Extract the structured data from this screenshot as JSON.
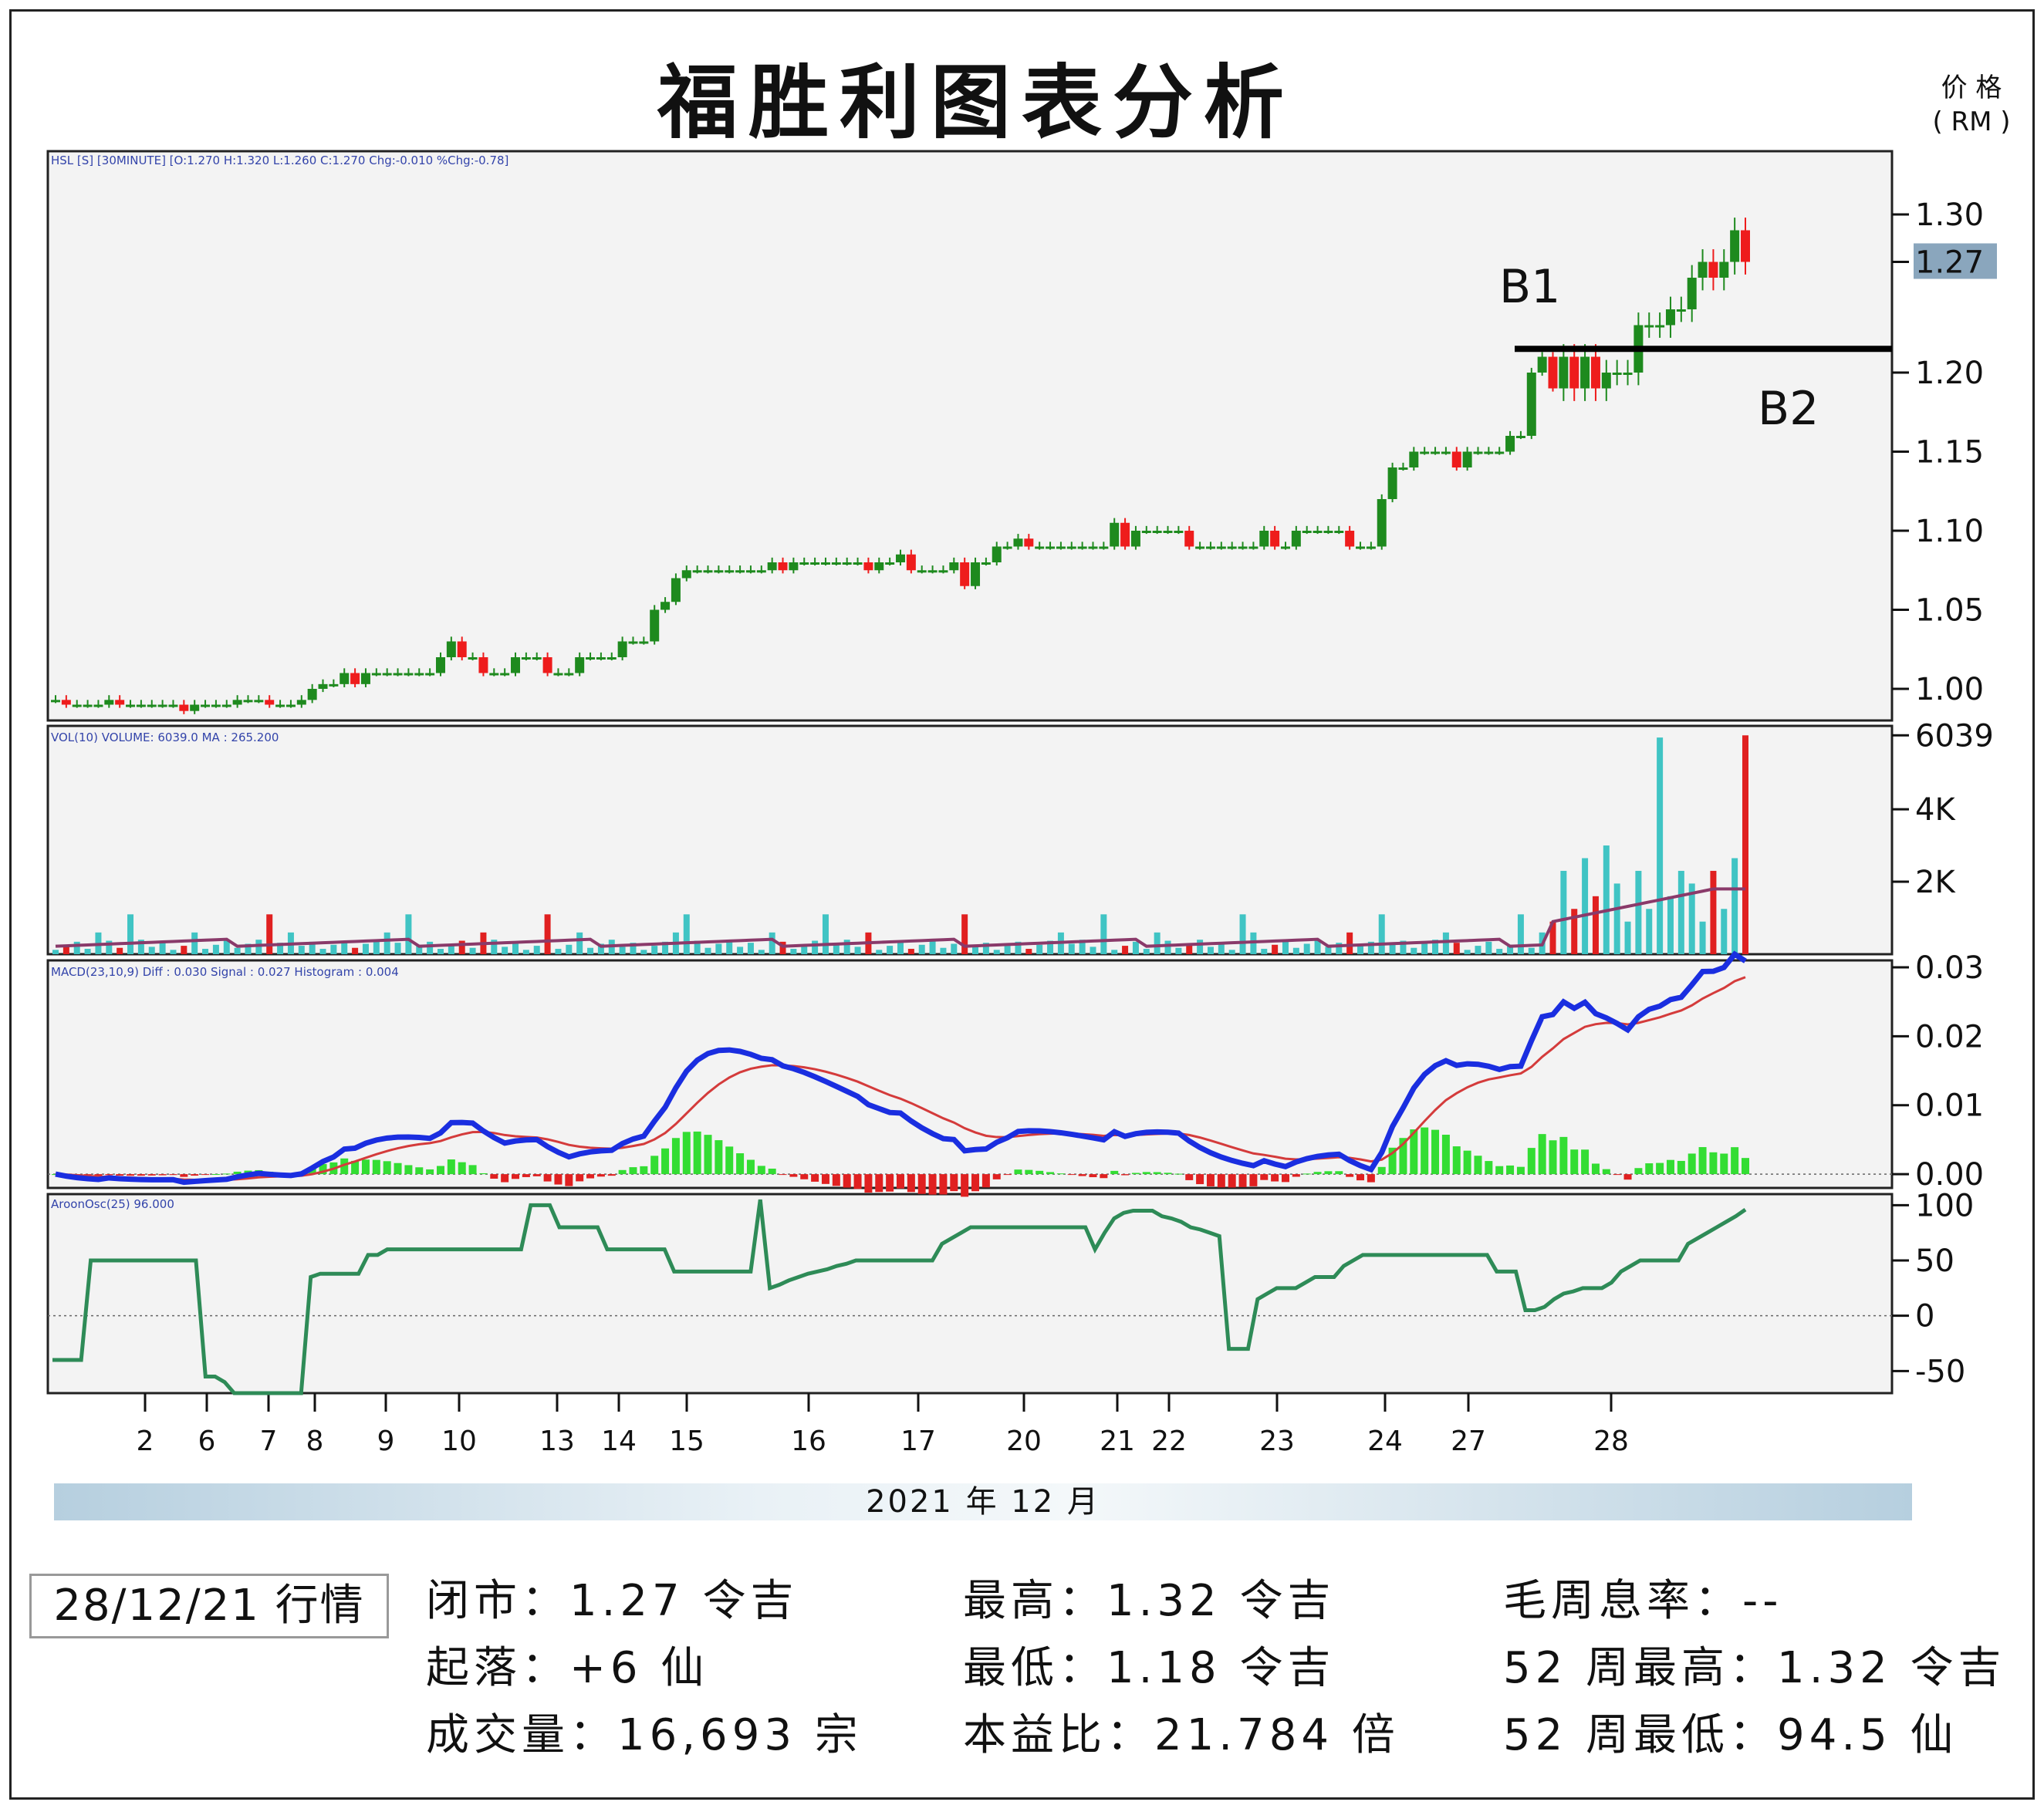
{
  "title": "福胜利图表分析",
  "price_unit": {
    "line1": "价 格",
    "line2": "( RM )"
  },
  "panels": {
    "price": {
      "label": "HSL [S] [30MINUTE] [O:1.270 H:1.320 L:1.260 C:1.270 Chg:-0.010 %Chg:-0.78]",
      "last_label": "1.27",
      "b1": "B1",
      "b2": "B2"
    },
    "volume": {
      "label": "VOL(10) VOLUME: 6039.0   MA : 265.200"
    },
    "macd": {
      "label": "MACD(23,10,9)  Diff : 0.030   Signal : 0.027   Histogram : 0.004"
    },
    "aroon": {
      "label": "AroonOsc(25) 96.000"
    }
  },
  "colors": {
    "up": "#1e8a1e",
    "down": "#ee1c1c",
    "macd_diff": "#1a2ee0",
    "macd_signal": "#d43b3b",
    "hist_up": "#33dd33",
    "hist_down": "#e02020",
    "vol_up": "#40c4c4",
    "vol_down": "#e02020",
    "vol_ma": "#8a3a6a",
    "aroon": "#2e8b57",
    "panel_bg": "#f3f3f3"
  },
  "chart_data": [
    {
      "type": "candlestick",
      "panel": "price",
      "x_dates": [
        "2",
        "6",
        "7",
        "8",
        "9",
        "10",
        "13",
        "14",
        "15",
        "16",
        "17",
        "20",
        "21",
        "22",
        "23",
        "24",
        "27",
        "28"
      ],
      "y_ticks": [
        "1.30",
        "1.27",
        "1.20",
        "1.15",
        "1.10",
        "1.05",
        "1.00"
      ],
      "ylim": [
        0.98,
        1.34
      ],
      "last_close": 1.27,
      "breakout_level": 1.215,
      "closes": [
        0.993,
        0.99,
        0.99,
        0.99,
        0.99,
        0.993,
        0.99,
        0.99,
        0.99,
        0.99,
        0.99,
        0.99,
        0.986,
        0.99,
        0.99,
        0.99,
        0.99,
        0.993,
        0.993,
        0.993,
        0.99,
        0.99,
        0.99,
        0.993,
        1.0,
        1.003,
        1.003,
        1.01,
        1.003,
        1.01,
        1.01,
        1.01,
        1.01,
        1.01,
        1.01,
        1.01,
        1.02,
        1.03,
        1.02,
        1.02,
        1.01,
        1.01,
        1.01,
        1.02,
        1.02,
        1.02,
        1.01,
        1.01,
        1.01,
        1.02,
        1.02,
        1.02,
        1.02,
        1.03,
        1.03,
        1.03,
        1.05,
        1.055,
        1.07,
        1.075,
        1.075,
        1.075,
        1.075,
        1.075,
        1.075,
        1.075,
        1.075,
        1.08,
        1.075,
        1.08,
        1.08,
        1.08,
        1.08,
        1.08,
        1.08,
        1.08,
        1.075,
        1.08,
        1.08,
        1.085,
        1.075,
        1.075,
        1.075,
        1.075,
        1.08,
        1.065,
        1.08,
        1.08,
        1.09,
        1.09,
        1.095,
        1.09,
        1.09,
        1.09,
        1.09,
        1.09,
        1.09,
        1.09,
        1.09,
        1.105,
        1.09,
        1.1,
        1.1,
        1.1,
        1.1,
        1.1,
        1.09,
        1.09,
        1.09,
        1.09,
        1.09,
        1.09,
        1.09,
        1.1,
        1.09,
        1.09,
        1.1,
        1.1,
        1.1,
        1.1,
        1.1,
        1.09,
        1.09,
        1.09,
        1.12,
        1.14,
        1.14,
        1.15,
        1.15,
        1.15,
        1.15,
        1.14,
        1.15,
        1.15,
        1.15,
        1.15,
        1.16,
        1.16,
        1.2,
        1.21,
        1.19,
        1.21,
        1.19,
        1.21,
        1.19,
        1.2,
        1.2,
        1.2,
        1.23,
        1.23,
        1.23,
        1.24,
        1.24,
        1.26,
        1.27,
        1.26,
        1.27,
        1.29,
        1.27
      ]
    },
    {
      "type": "bar",
      "panel": "volume",
      "y_ticks": [
        "6039",
        "4K",
        "2K"
      ],
      "ylim": [
        0,
        6300
      ],
      "last_volume": 6039,
      "ma": 265.2
    },
    {
      "type": "line",
      "panel": "macd",
      "y_ticks": [
        "0.03",
        "0.02",
        "0.01",
        "0.00"
      ],
      "ylim": [
        -0.002,
        0.031
      ],
      "series": [
        {
          "name": "Diff",
          "last": 0.03
        },
        {
          "name": "Signal",
          "last": 0.027
        },
        {
          "name": "Histogram",
          "last": 0.004
        }
      ]
    },
    {
      "type": "line",
      "panel": "aroon",
      "y_ticks": [
        "100",
        "50",
        "0",
        "-50"
      ],
      "ylim": [
        -70,
        110
      ],
      "last": 96.0,
      "values": [
        -40,
        -40,
        -40,
        -40,
        50,
        50,
        50,
        50,
        50,
        50,
        50,
        50,
        50,
        50,
        50,
        50,
        -55,
        -55,
        -60,
        -70,
        -70,
        -70,
        -70,
        -70,
        -70,
        -70,
        -70,
        35,
        38,
        38,
        38,
        38,
        38,
        55,
        55,
        60,
        60,
        60,
        60,
        60,
        60,
        60,
        60,
        60,
        60,
        60,
        60,
        60,
        60,
        60,
        100,
        100,
        100,
        80,
        80,
        80,
        80,
        80,
        60,
        60,
        60,
        60,
        60,
        60,
        60,
        40,
        40,
        40,
        40,
        40,
        40,
        40,
        40,
        40,
        105,
        25,
        28,
        32,
        35,
        38,
        40,
        42,
        45,
        47,
        50,
        50,
        50,
        50,
        50,
        50,
        50,
        50,
        50,
        65,
        70,
        75,
        80,
        80,
        80,
        80,
        80,
        80,
        80,
        80,
        80,
        80,
        80,
        80,
        80,
        60,
        75,
        88,
        93,
        95,
        95,
        95,
        90,
        88,
        85,
        80,
        78,
        75,
        72,
        -30,
        -30,
        -30,
        15,
        20,
        25,
        25,
        25,
        30,
        35,
        35,
        35,
        45,
        50,
        55,
        55,
        55,
        55,
        55,
        55,
        55,
        55,
        55,
        55,
        55,
        55,
        55,
        55,
        40,
        40,
        40,
        5,
        5,
        8,
        15,
        20,
        22,
        25,
        25,
        25,
        30,
        40,
        45,
        50,
        50,
        50,
        50,
        50,
        65,
        70,
        75,
        80,
        85,
        90,
        96
      ]
    }
  ],
  "x_axis_label": "2021 年 12 月",
  "stats": {
    "date": "28/12/21 行情",
    "col1": [
      "闭市：1.27 令吉",
      "起落：+6 仙",
      "成交量：16,693 宗"
    ],
    "col2": [
      "最高：1.32 令吉",
      "最低：1.18 令吉",
      "本益比：21.784 倍"
    ],
    "col3": [
      "毛周息率：--",
      "52 周最高：1.32 令吉",
      "52 周最低：94.5 仙"
    ]
  }
}
